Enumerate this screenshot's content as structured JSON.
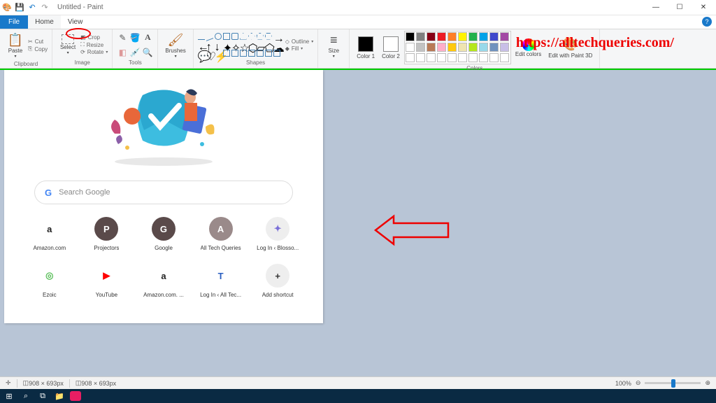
{
  "title": "Untitled - Paint",
  "watermark": "https://alltechqueries.com/",
  "tabs": {
    "file": "File",
    "home": "Home",
    "view": "View"
  },
  "ribbon": {
    "clipboard": {
      "label": "Clipboard",
      "paste": "Paste",
      "cut": "Cut",
      "copy": "Copy"
    },
    "image": {
      "label": "Image",
      "select": "Select",
      "crop": "Crop",
      "resize": "Resize",
      "rotate": "Rotate"
    },
    "tools": {
      "label": "Tools"
    },
    "brushes": "Brushes",
    "shapes": {
      "label": "Shapes",
      "outline": "Outline",
      "fill": "Fill"
    },
    "size": "Size",
    "colors": {
      "label": "Colors",
      "c1": "Color 1",
      "c2": "Color 2",
      "edit": "Edit colors",
      "p3d": "Edit with Paint 3D"
    }
  },
  "palette": [
    "#000",
    "#7f7f7f",
    "#880015",
    "#ed1c24",
    "#ff7f27",
    "#fff200",
    "#22b14c",
    "#00a2e8",
    "#3f48cc",
    "#a349a4",
    "#fff",
    "#c3c3c3",
    "#b97a57",
    "#ffaec9",
    "#ffc90e",
    "#efe4b0",
    "#b5e61d",
    "#99d9ea",
    "#7092be",
    "#c8bfe7",
    "#fff",
    "#fff",
    "#fff",
    "#fff",
    "#fff",
    "#fff",
    "#fff",
    "#fff",
    "#fff",
    "#fff"
  ],
  "search_placeholder": "Search Google",
  "tiles": [
    {
      "name": "Amazon.com",
      "bg": "#fff",
      "fg": "#222",
      "txt": "a"
    },
    {
      "name": "Projectors",
      "bg": "#5a4a4a",
      "fg": "#fff",
      "txt": "P"
    },
    {
      "name": "Google",
      "bg": "#5a4a4a",
      "fg": "#fff",
      "txt": "G"
    },
    {
      "name": "All Tech Queries",
      "bg": "#9a8a8a",
      "fg": "#fff",
      "txt": "A"
    },
    {
      "name": "Log In ‹ Blosso...",
      "bg": "#eee",
      "fg": "#7a6fd8",
      "txt": "✦"
    },
    {
      "name": "Ezoic",
      "bg": "#fff",
      "fg": "#5bbf5b",
      "txt": "◎"
    },
    {
      "name": "YouTube",
      "bg": "#fff",
      "fg": "#f00",
      "txt": "▶"
    },
    {
      "name": "Amazon.com. ...",
      "bg": "#fff",
      "fg": "#222",
      "txt": "a"
    },
    {
      "name": "Log In ‹ All Tec...",
      "bg": "#fff",
      "fg": "#2b5fc1",
      "txt": "T"
    },
    {
      "name": "Add shortcut",
      "bg": "#eee",
      "fg": "#333",
      "txt": "+"
    }
  ],
  "status": {
    "dim1": "908 × 693px",
    "dim2": "908 × 693px",
    "zoom": "100%"
  }
}
